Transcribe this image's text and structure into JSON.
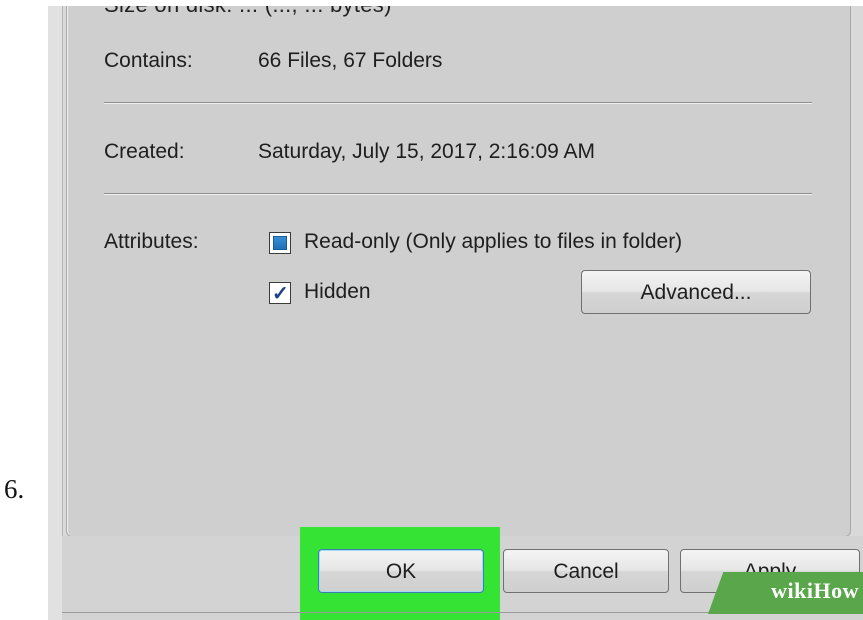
{
  "step_number": "6.",
  "dialog": {
    "cut_off_row": "Size on disk:   ... (..., ... bytes)",
    "contains": {
      "label": "Contains:",
      "value": "66 Files, 67 Folders"
    },
    "created": {
      "label": "Created:",
      "value": "Saturday, July 15, 2017, 2:16:09 AM"
    },
    "attributes": {
      "label": "Attributes:",
      "read_only": {
        "label": "Read-only (Only applies to files in folder)",
        "state": "indeterminate"
      },
      "hidden": {
        "label": "Hidden",
        "checked": true,
        "check_glyph": "✓"
      },
      "advanced_button": "Advanced..."
    },
    "buttons": {
      "ok": "OK",
      "cancel": "Cancel",
      "apply": "Apply"
    }
  },
  "highlight_color": "#35e335",
  "watermark": "wikiHow"
}
